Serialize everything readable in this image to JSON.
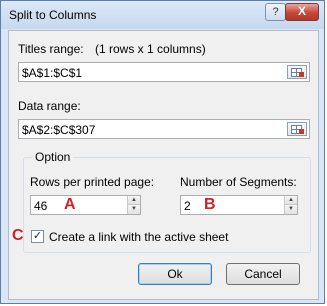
{
  "window": {
    "title": "Split to Columns",
    "help_label": "?",
    "close_label": "X"
  },
  "titles_range": {
    "label": "Titles range:",
    "info": "(1 rows x 1 columns)",
    "value": "$A$1:$C$1"
  },
  "data_range": {
    "label": "Data range:",
    "value": "$A$2:$C$307"
  },
  "option": {
    "group_label": "Option",
    "rows_label": "Rows per printed page:",
    "rows_value": "46",
    "rows_marker": "A",
    "segments_label": "Number of Segments:",
    "segments_value": "2",
    "segments_marker": "B",
    "link_marker": "C",
    "link_label": "Create a link with the active sheet",
    "link_checked": "✓"
  },
  "buttons": {
    "ok": "Ok",
    "cancel": "Cancel"
  },
  "colors": {
    "marker": "#c8262b",
    "frame": "#d9e6f5"
  }
}
